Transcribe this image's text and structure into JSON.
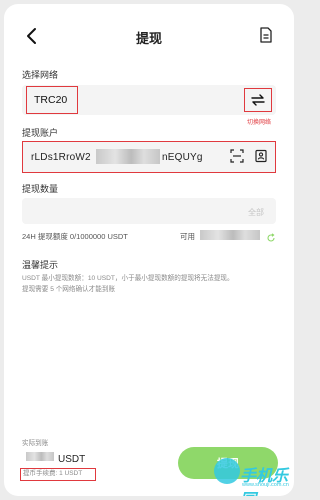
{
  "header": {
    "title": "提现"
  },
  "network": {
    "section_label": "选择网络",
    "value": "TRC20",
    "swap_note": "切换网络"
  },
  "account": {
    "section_label": "提现账户",
    "address_start": "rLDs1RroW2",
    "address_end": "nEQUYg"
  },
  "amount": {
    "section_label": "提现数量",
    "all_label": "全部",
    "limit_text": "24H 提现额度 0/1000000 USDT",
    "available_label": "可用"
  },
  "tips": {
    "title": "温馨提示",
    "line1": "USDT 最小提现数额：10 USDT，小于最小提现数额的提现将无法提现。",
    "line2": "提现需要 5 个网络确认才能到账"
  },
  "footer": {
    "received_label": "实际到账",
    "received_unit": "USDT",
    "fee_text": "提币手续费: 1 USDT",
    "withdraw_label": "提现"
  },
  "watermark": {
    "text": "手机乐园",
    "url": "www.shouji.com.cn"
  },
  "colors": {
    "highlight": "#e0393e",
    "accent": "#8fd86a",
    "watermark": "#33c9e0"
  }
}
